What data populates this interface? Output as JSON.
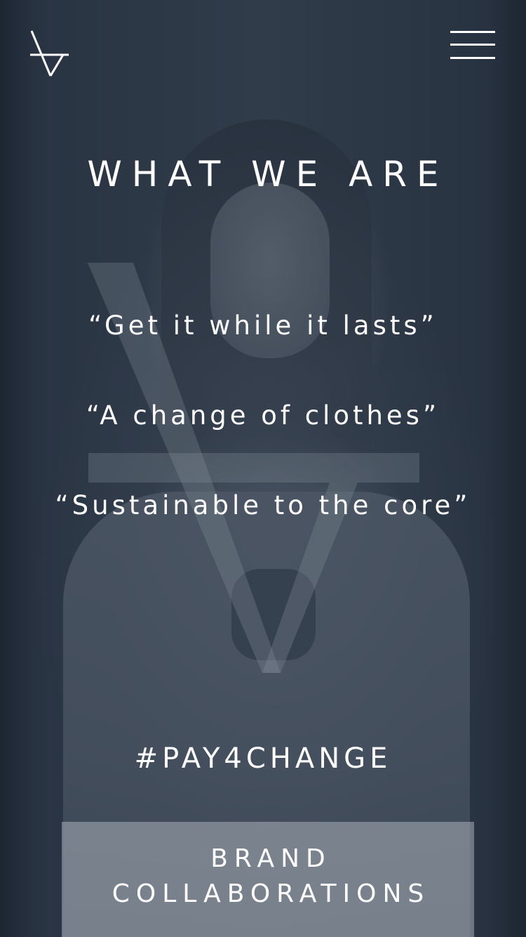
{
  "header": {
    "logo_icon": "brand-monogram-icon",
    "menu_icon": "hamburger-menu-icon"
  },
  "main": {
    "title": "WHAT WE ARE",
    "quotes": [
      "“Get it while it lasts”",
      "“A change of clothes”",
      "“Sustainable to the core”"
    ],
    "hashtag": "#PAY4CHANGE",
    "cta_line1": "BRAND",
    "cta_line2": "COLLABORATIONS"
  },
  "colors": {
    "overlay": "#263242",
    "text": "#ffffff",
    "cta_background": "#aab0b8"
  }
}
